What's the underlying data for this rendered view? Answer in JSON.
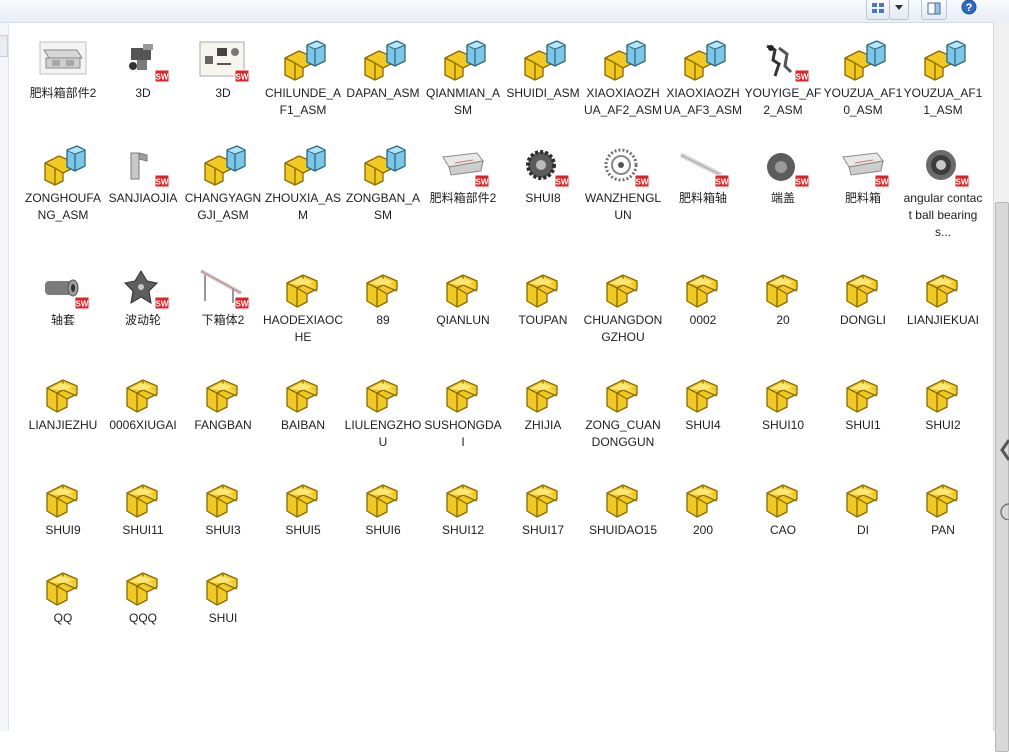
{
  "toolbar": {
    "view_icon": "view-grid-icon",
    "dropdown_icon": "chevron-down-icon",
    "pane_icon": "preview-pane-icon",
    "help_label": "?"
  },
  "colors": {
    "part_yellow": "#f2c922",
    "asm_blue": "#7cc7e6",
    "sw_red": "#d9262b"
  },
  "files": [
    {
      "name": "肥料箱部件2",
      "icon": "assembly-thumbnail-icon",
      "thumb": "boxasm"
    },
    {
      "name": "3D",
      "icon": "part-thumbnail-icon",
      "thumb": "mech"
    },
    {
      "name": "3D",
      "icon": "drawing-thumbnail-icon",
      "thumb": "drawing"
    },
    {
      "name": "CHILUNDE_AF1_ASM",
      "icon": "assembly-icon",
      "thumb": "asm"
    },
    {
      "name": "DAPAN_ASM",
      "icon": "assembly-icon",
      "thumb": "asm"
    },
    {
      "name": "QIANMIAN_ASM",
      "icon": "assembly-icon",
      "thumb": "asm"
    },
    {
      "name": "SHUIDI_ASM",
      "icon": "assembly-icon",
      "thumb": "asm"
    },
    {
      "name": "XIAOXIAOZHUA_AF2_ASM",
      "icon": "assembly-icon",
      "thumb": "asm"
    },
    {
      "name": "XIAOXIAOZHUA_AF3_ASM",
      "icon": "assembly-icon",
      "thumb": "asm"
    },
    {
      "name": "YOUYIGE_AF2_ASM",
      "icon": "part-thumbnail-icon",
      "thumb": "claw"
    },
    {
      "name": "YOUZUA_AF10_ASM",
      "icon": "assembly-icon",
      "thumb": "asm"
    },
    {
      "name": "YOUZUA_AF11_ASM",
      "icon": "assembly-icon",
      "thumb": "asm"
    },
    {
      "name": "ZONGHOUFANG_ASM",
      "icon": "assembly-icon",
      "thumb": "asm"
    },
    {
      "name": "SANJIAOJIA",
      "icon": "part-thumbnail-icon",
      "thumb": "bracket"
    },
    {
      "name": "CHANGYAGNGJI_ASM",
      "icon": "assembly-icon",
      "thumb": "asm"
    },
    {
      "name": "ZHOUXIA_ASM",
      "icon": "assembly-icon",
      "thumb": "asm"
    },
    {
      "name": "ZONGBAN_ASM",
      "icon": "assembly-icon",
      "thumb": "asm"
    },
    {
      "name": "肥料箱部件2",
      "icon": "part-thumbnail-icon",
      "thumb": "tray"
    },
    {
      "name": "SHUI8",
      "icon": "part-thumbnail-icon",
      "thumb": "gear"
    },
    {
      "name": "WANZHENGLUN",
      "icon": "part-thumbnail-icon",
      "thumb": "wheel"
    },
    {
      "name": "肥料箱轴",
      "icon": "part-thumbnail-icon",
      "thumb": "shaft"
    },
    {
      "name": "端盖",
      "icon": "part-thumbnail-icon",
      "thumb": "cap"
    },
    {
      "name": "肥料箱",
      "icon": "part-thumbnail-icon",
      "thumb": "tray"
    },
    {
      "name": "angular contact ball bearings...",
      "icon": "part-thumbnail-icon",
      "thumb": "bearing"
    },
    {
      "name": "轴套",
      "icon": "part-thumbnail-icon",
      "thumb": "sleeve"
    },
    {
      "name": "波动轮",
      "icon": "part-thumbnail-icon",
      "thumb": "star"
    },
    {
      "name": "下箱体2",
      "icon": "part-thumbnail-icon",
      "thumb": "rail"
    },
    {
      "name": "HAODEXIAOCHE",
      "icon": "part-icon",
      "thumb": "part"
    },
    {
      "name": "89",
      "icon": "part-icon",
      "thumb": "part"
    },
    {
      "name": "QIANLUN",
      "icon": "part-icon",
      "thumb": "part"
    },
    {
      "name": "TOUPAN",
      "icon": "part-icon",
      "thumb": "part"
    },
    {
      "name": "CHUANGDONGZHOU",
      "icon": "part-icon",
      "thumb": "part"
    },
    {
      "name": "0002",
      "icon": "part-icon",
      "thumb": "part"
    },
    {
      "name": "20",
      "icon": "part-icon",
      "thumb": "part"
    },
    {
      "name": "DONGLI",
      "icon": "part-icon",
      "thumb": "part"
    },
    {
      "name": "LIANJIEKUAI",
      "icon": "part-icon",
      "thumb": "part"
    },
    {
      "name": "LIANJIEZHU",
      "icon": "part-icon",
      "thumb": "part"
    },
    {
      "name": "0006XIUGAI",
      "icon": "part-icon",
      "thumb": "part"
    },
    {
      "name": "FANGBAN",
      "icon": "part-icon",
      "thumb": "part"
    },
    {
      "name": "BAIBAN",
      "icon": "part-icon",
      "thumb": "part"
    },
    {
      "name": "LIULENGZHOU",
      "icon": "part-icon",
      "thumb": "part"
    },
    {
      "name": "SUSHONGDAI",
      "icon": "part-icon",
      "thumb": "part"
    },
    {
      "name": "ZHIJIA",
      "icon": "part-icon",
      "thumb": "part"
    },
    {
      "name": "ZONG_CUANDONGGUN",
      "icon": "part-icon",
      "thumb": "part"
    },
    {
      "name": "SHUI4",
      "icon": "part-icon",
      "thumb": "part"
    },
    {
      "name": "SHUI10",
      "icon": "part-icon",
      "thumb": "part"
    },
    {
      "name": "SHUI1",
      "icon": "part-icon",
      "thumb": "part"
    },
    {
      "name": "SHUI2",
      "icon": "part-icon",
      "thumb": "part"
    },
    {
      "name": "SHUI9",
      "icon": "part-icon",
      "thumb": "part"
    },
    {
      "name": "SHUI11",
      "icon": "part-icon",
      "thumb": "part"
    },
    {
      "name": "SHUI3",
      "icon": "part-icon",
      "thumb": "part"
    },
    {
      "name": "SHUI5",
      "icon": "part-icon",
      "thumb": "part"
    },
    {
      "name": "SHUI6",
      "icon": "part-icon",
      "thumb": "part"
    },
    {
      "name": "SHUI12",
      "icon": "part-icon",
      "thumb": "part"
    },
    {
      "name": "SHUI17",
      "icon": "part-icon",
      "thumb": "part"
    },
    {
      "name": "SHUIDAO15",
      "icon": "part-icon",
      "thumb": "part"
    },
    {
      "name": "200",
      "icon": "part-icon",
      "thumb": "part"
    },
    {
      "name": "CAO",
      "icon": "part-icon",
      "thumb": "part"
    },
    {
      "name": "DI",
      "icon": "part-icon",
      "thumb": "part"
    },
    {
      "name": "PAN",
      "icon": "part-icon",
      "thumb": "part"
    },
    {
      "name": "QQ",
      "icon": "part-icon",
      "thumb": "part"
    },
    {
      "name": "QQQ",
      "icon": "part-icon",
      "thumb": "part"
    },
    {
      "name": "SHUI",
      "icon": "part-icon",
      "thumb": "part"
    }
  ]
}
